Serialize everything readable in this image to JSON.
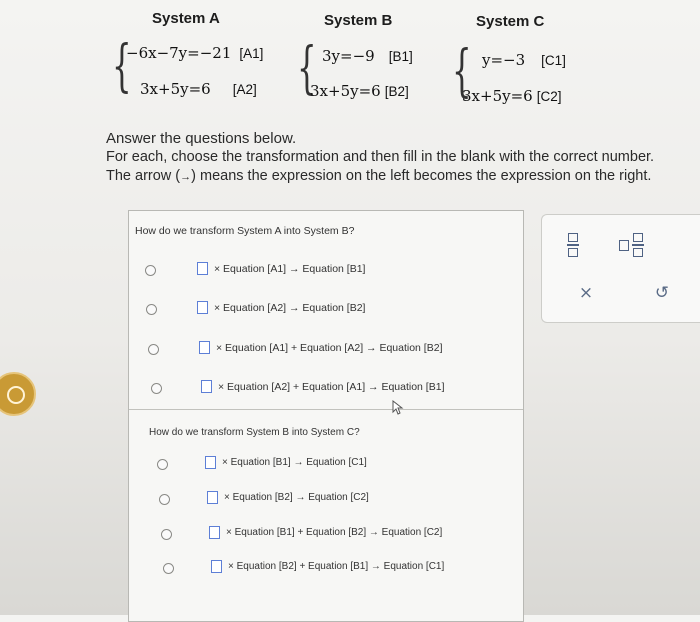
{
  "systems": {
    "a": {
      "title": "System A",
      "eq1": "−6x−7y=−21",
      "tag1": "[A1]",
      "eq2": "3x+5y=6",
      "tag2": "[A2]"
    },
    "b": {
      "title": "System B",
      "eq1": "3y=−9",
      "tag1": "[B1]",
      "eq2": "3x+5y=6",
      "tag2": "[B2]"
    },
    "c": {
      "title": "System C",
      "eq1": "y=−3",
      "tag1": "[C1]",
      "eq2": "3x+5y=6",
      "tag2": "[C2]"
    }
  },
  "instructions": {
    "line1": "Answer the questions below.",
    "line2": "For each, choose the transformation and then fill in the blank with the correct number.",
    "line3_pre": "The arrow (",
    "arrow": "→",
    "line3_post": ") means the expression on the left becomes the expression on the right."
  },
  "q1": {
    "question": "How do we transform System A into System B?",
    "options": [
      "× Equation [A1] → Equation [B1]",
      "× Equation [A2] → Equation [B2]",
      "× Equation [A1] + Equation [A2] → Equation [B2]",
      "× Equation [A2] + Equation [A1] → Equation [B1]"
    ]
  },
  "q2": {
    "question": "How do we transform System B into System C?",
    "options": [
      "× Equation [B1] → Equation [C1]",
      "× Equation [B2] → Equation [C2]",
      "× Equation [B1] + Equation [B2] → Equation [C2]",
      "× Equation [B2] + Equation [B1] → Equation [C1]"
    ]
  },
  "tools": {
    "clear": "×",
    "undo": "↺"
  },
  "colors": {
    "blank_border": "#5d7fd6",
    "tool_icon": "#5a6b86"
  }
}
